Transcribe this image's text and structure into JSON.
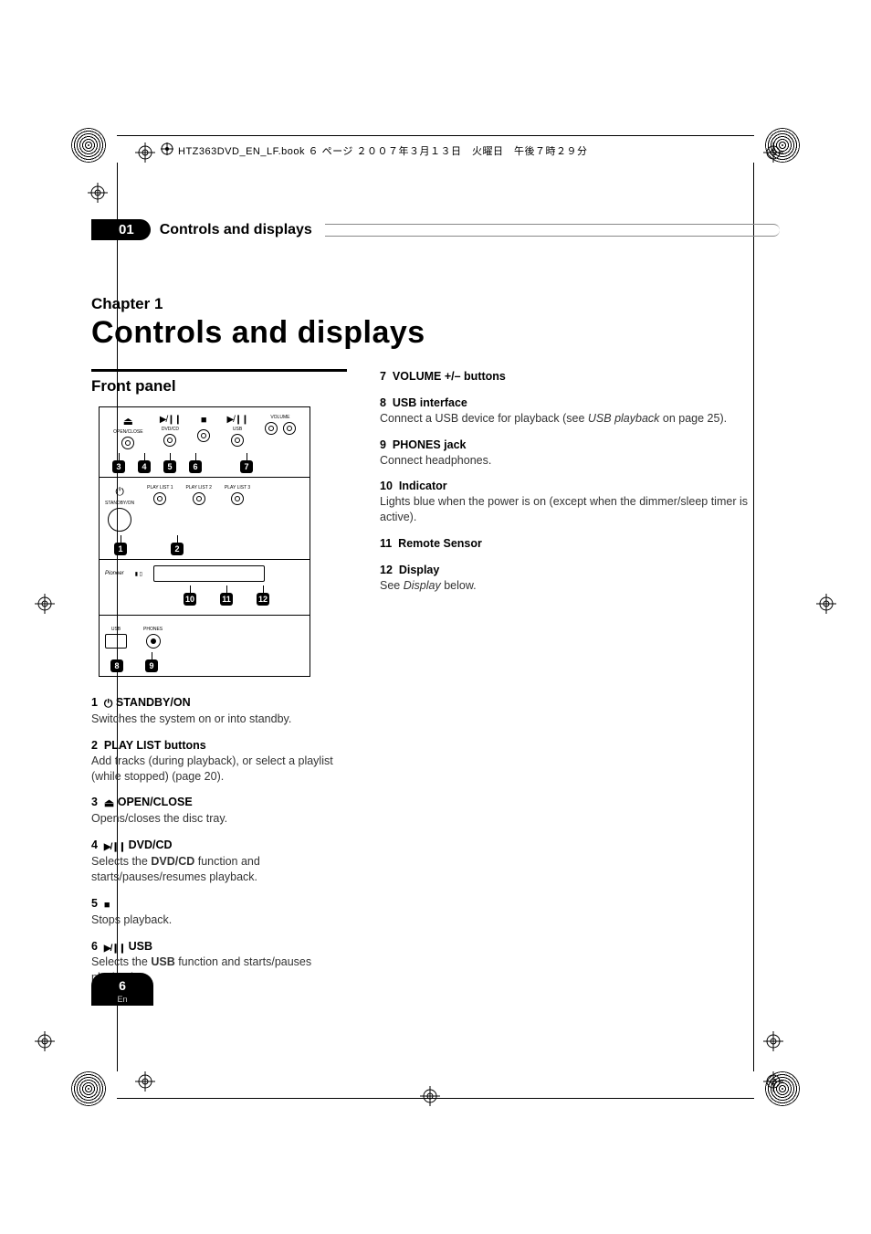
{
  "print": {
    "filename_line": "HTZ363DVD_EN_LF.book  ６ ページ  ２００７年３月１３日　火曜日　午後７時２９分"
  },
  "header": {
    "chapter_num": "01",
    "chapter_bar_title": "Controls and displays"
  },
  "chapter": {
    "label": "Chapter 1",
    "title": "Controls and displays"
  },
  "front_panel_heading": "Front panel",
  "diagram": {
    "row1_labels": [
      "OPEN/CLOSE",
      "DVD/CD",
      "",
      "USB",
      "VOLUME"
    ],
    "row1_callouts": [
      "3",
      "4",
      "5",
      "6",
      "7"
    ],
    "row2_labels": [
      "STANDBY/ON",
      "PLAY LIST 1",
      "PLAY LIST 2",
      "PLAY LIST 3"
    ],
    "row2_callouts": [
      "1",
      "2"
    ],
    "row3_callouts": [
      "10",
      "11",
      "12"
    ],
    "row4_labels": [
      "USB",
      "PHONES"
    ],
    "row4_callouts": [
      "8",
      "9"
    ]
  },
  "items_left": [
    {
      "num": "1",
      "icon": "power",
      "title": "STANDBY/ON",
      "body": "Switches the system on or into standby."
    },
    {
      "num": "2",
      "title": "PLAY LIST buttons",
      "body": "Add tracks (during playback), or select a playlist (while stopped) (page 20)."
    },
    {
      "num": "3",
      "icon": "eject",
      "title": "OPEN/CLOSE",
      "body": "Opens/closes the disc tray."
    },
    {
      "num": "4",
      "icon": "playpause",
      "title": "DVD/CD",
      "body_pre": "Selects the ",
      "body_bold": "DVD/CD",
      "body_post": " function and starts/pauses/resumes playback."
    },
    {
      "num": "5",
      "icon": "stop",
      "title": "",
      "body": "Stops playback."
    },
    {
      "num": "6",
      "icon": "playpause",
      "title": "USB",
      "body_pre": "Selects the ",
      "body_bold": "USB",
      "body_post": " function and starts/pauses playback."
    }
  ],
  "items_right": [
    {
      "num": "7",
      "title": "VOLUME +/– buttons",
      "body": ""
    },
    {
      "num": "8",
      "title": "USB interface",
      "body_pre": "Connect a USB device for playback (see ",
      "body_ital": "USB playback",
      "body_post": " on page 25)."
    },
    {
      "num": "9",
      "title": "PHONES jack",
      "body": "Connect headphones."
    },
    {
      "num": "10",
      "title": "Indicator",
      "body": "Lights blue when the power is on (except when the dimmer/sleep timer is active)."
    },
    {
      "num": "11",
      "title": "Remote Sensor",
      "body": ""
    },
    {
      "num": "12",
      "title": "Display",
      "body_pre": "See ",
      "body_ital": "Display",
      "body_post": " below."
    }
  ],
  "footer": {
    "page_number": "6",
    "lang": "En"
  }
}
